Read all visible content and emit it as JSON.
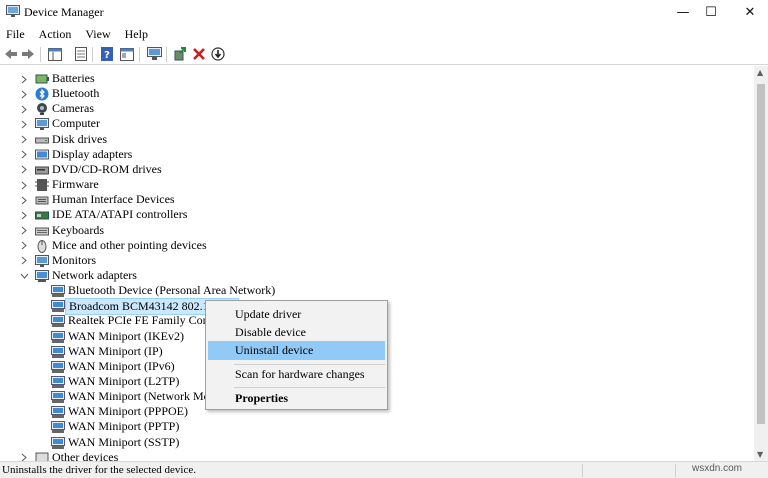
{
  "window": {
    "title": "Device Manager",
    "controls": {
      "minimize": "—",
      "maximize": "☐",
      "close": "✕"
    }
  },
  "menu": [
    "File",
    "Action",
    "View",
    "Help"
  ],
  "toolbar": {
    "buttons": [
      "back-arrow-icon",
      "forward-arrow-icon",
      "show-hide-console-tree-icon",
      "properties-sheet-icon",
      "help-icon",
      "view-icon",
      "scan-hardware-icon",
      "update-driver-icon",
      "uninstall-x-icon",
      "download-arrow-icon"
    ]
  },
  "tree": {
    "categories": [
      {
        "label": "Batteries",
        "icon": "battery-icon"
      },
      {
        "label": "Bluetooth",
        "icon": "bluetooth-icon"
      },
      {
        "label": "Cameras",
        "icon": "camera-icon"
      },
      {
        "label": "Computer",
        "icon": "monitor-icon"
      },
      {
        "label": "Disk drives",
        "icon": "disk-drive-icon"
      },
      {
        "label": "Display adapters",
        "icon": "display-adapter-icon"
      },
      {
        "label": "DVD/CD-ROM drives",
        "icon": "dvd-drive-icon"
      },
      {
        "label": "Firmware",
        "icon": "firmware-icon"
      },
      {
        "label": "Human Interface Devices",
        "icon": "hid-icon"
      },
      {
        "label": "IDE ATA/ATAPI controllers",
        "icon": "ide-controller-icon"
      },
      {
        "label": "Keyboards",
        "icon": "keyboard-icon"
      },
      {
        "label": "Mice and other pointing devices",
        "icon": "mouse-icon"
      },
      {
        "label": "Monitors",
        "icon": "monitor-icon"
      },
      {
        "label": "Network adapters",
        "icon": "network-adapter-icon",
        "expanded": true
      }
    ],
    "network_adapters": [
      "Bluetooth Device (Personal Area Network)",
      "Broadcom BCM43142 802.11 bgn",
      "Realtek PCIe FE Family Controller",
      "WAN Miniport (IKEv2)",
      "WAN Miniport (IP)",
      "WAN Miniport (IPv6)",
      "WAN Miniport (L2TP)",
      "WAN Miniport (Network Monitor)",
      "WAN Miniport (PPPOE)",
      "WAN Miniport (PPTP)",
      "WAN Miniport (SSTP)"
    ],
    "partial_category": "Other devices",
    "selected_device": "Broadcom BCM43142 802.11 bgn"
  },
  "context_menu": {
    "items": [
      "Update driver",
      "Disable device",
      "Uninstall device",
      "Scan for hardware changes",
      "Properties"
    ],
    "highlighted": "Uninstall device",
    "bold_item": "Properties"
  },
  "status": {
    "text": "Uninstalls the driver for the selected device."
  },
  "watermark": "wsxdn.com",
  "colors": {
    "selection": "#cce8ff",
    "menu_highlight": "#91c9f7",
    "uninstall_red": "#d11a1a",
    "install_green": "#1e8a3c",
    "icon_blue": "#2b7bd3"
  }
}
